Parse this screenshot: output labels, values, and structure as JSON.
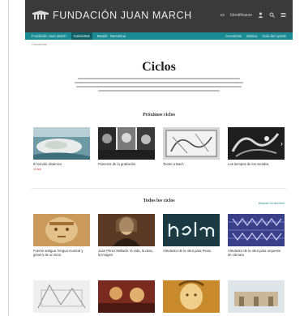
{
  "header": {
    "brand": "FUNDACIÓN JUAN MARCH",
    "util_links": [
      "es",
      "Identificarse"
    ],
    "icons": [
      "user-icon",
      "search-icon",
      "menu-icon"
    ]
  },
  "nav": {
    "left": [
      "Fundación Juan March",
      "Conciertos",
      "Madrid · Barcelona"
    ],
    "active_index": 1,
    "right": [
      "Conciertos",
      "Música",
      "Guía del oyente"
    ]
  },
  "breadcrumb": "Conciertos",
  "page_title": "Ciclos",
  "sections": {
    "upcoming": {
      "title": "Próximos ciclos"
    },
    "all": {
      "title": "Todos los ciclos",
      "link": "Buscar en archivo"
    }
  },
  "upcoming_cards": [
    {
      "caption": "El sonido dinámico",
      "date": "12 feb"
    },
    {
      "caption": "Pioneros de la grabación",
      "date": ""
    },
    {
      "caption": "Tiento a Bach",
      "date": ""
    },
    {
      "caption": "Los tiempos de los sonidos",
      "date": ""
    }
  ],
  "all_cards": [
    {
      "caption": "Fuente antigua: lengua musical y género de un tono",
      "date": ""
    },
    {
      "caption": "Juan Pérez Mellado: la vida, la obra, la imagen",
      "date": ""
    },
    {
      "caption": "Alrededor de la obra para Piano",
      "date": ""
    },
    {
      "caption": "Alrededor de la obra para orquesta de cámara",
      "date": ""
    },
    {
      "caption": "",
      "date": ""
    },
    {
      "caption": "",
      "date": ""
    },
    {
      "caption": "",
      "date": ""
    },
    {
      "caption": "",
      "date": ""
    }
  ],
  "colors": {
    "topbar": "#3a3a3a",
    "nav": "#1a8a93",
    "nav_active": "#0f5f66",
    "date_accent": "#d0302e"
  }
}
